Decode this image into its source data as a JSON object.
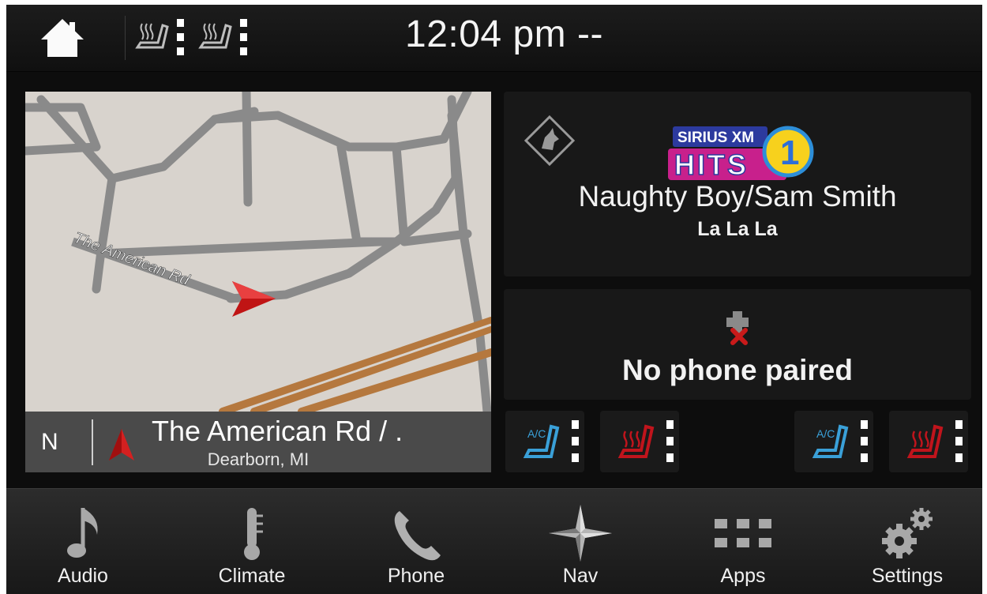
{
  "topbar": {
    "clock": "12:04 pm --",
    "icons": [
      "home-icon",
      "heated-seat-driver-icon",
      "heated-seat-passenger-icon"
    ]
  },
  "map": {
    "road_label": "The American Rd",
    "compass": "N",
    "street": "The American Rd / .",
    "city": "Dearborn, MI"
  },
  "audio": {
    "station_logo": "SIRIUS XM HITS 1",
    "logo_line1": "SIRIUS XM",
    "logo_line2": "HITS",
    "logo_channel": "1",
    "artist": "Naughty Boy/Sam Smith",
    "song": "La La La"
  },
  "phone": {
    "status": "No phone paired"
  },
  "seat_buttons": [
    {
      "name": "cooled-seat-driver",
      "label": "A/C",
      "color": "#3aa0d8"
    },
    {
      "name": "heated-seat-driver",
      "color": "#c0141c"
    },
    {
      "name": "cooled-seat-passenger",
      "label": "A/C",
      "color": "#3aa0d8"
    },
    {
      "name": "heated-seat-passenger",
      "color": "#c0141c"
    }
  ],
  "nav": {
    "audio": "Audio",
    "climate": "Climate",
    "phone": "Phone",
    "nav": "Nav",
    "apps": "Apps",
    "settings": "Settings"
  }
}
